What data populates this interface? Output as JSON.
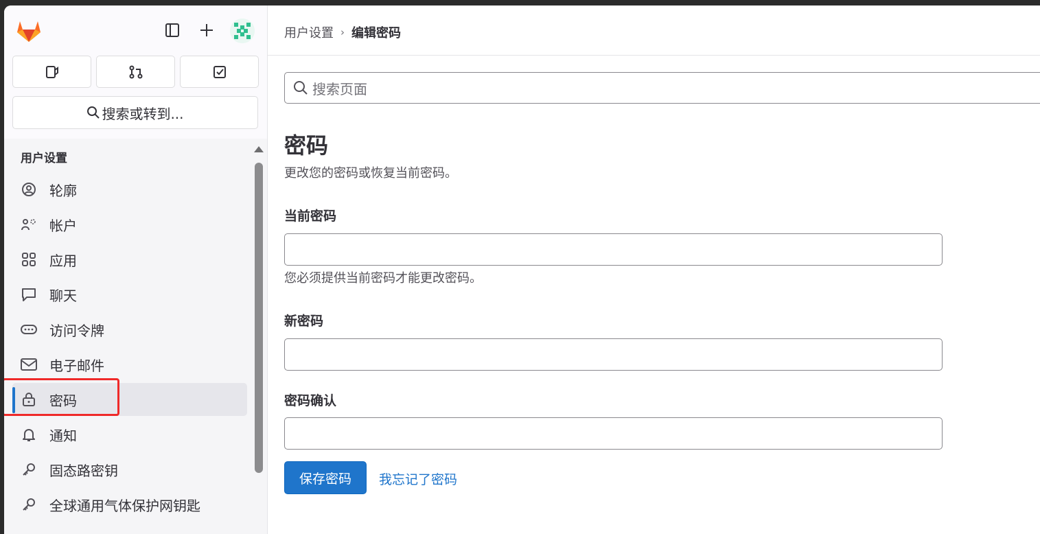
{
  "breadcrumb": {
    "parent": "用户设置",
    "separator": "›",
    "current": "编辑密码"
  },
  "sidebar": {
    "search_label": "搜索或转到...",
    "section_title": "用户设置",
    "items": [
      {
        "label": "轮廓",
        "icon": "profile-icon"
      },
      {
        "label": "帐户",
        "icon": "account-icon"
      },
      {
        "label": "应用",
        "icon": "applications-icon"
      },
      {
        "label": "聊天",
        "icon": "chat-icon"
      },
      {
        "label": "访问令牌",
        "icon": "token-icon"
      },
      {
        "label": "电子邮件",
        "icon": "mail-icon"
      },
      {
        "label": "密码",
        "icon": "lock-icon",
        "active": true
      },
      {
        "label": "通知",
        "icon": "bell-icon"
      },
      {
        "label": "固态路密钥",
        "icon": "key-icon"
      },
      {
        "label": "全球通用气体保护网钥匙",
        "icon": "key-icon"
      }
    ]
  },
  "main": {
    "search_placeholder": "搜索页面",
    "title": "密码",
    "subtitle": "更改您的密码或恢复当前密码。",
    "current_password_label": "当前密码",
    "current_password_help": "您必须提供当前密码才能更改密码。",
    "new_password_label": "新密码",
    "confirm_password_label": "密码确认",
    "save_button": "保存密码",
    "forgot_link": "我忘记了密码"
  },
  "colors": {
    "accent": "#1f75cb",
    "highlight": "#ef2929",
    "brand": "#e24329"
  }
}
